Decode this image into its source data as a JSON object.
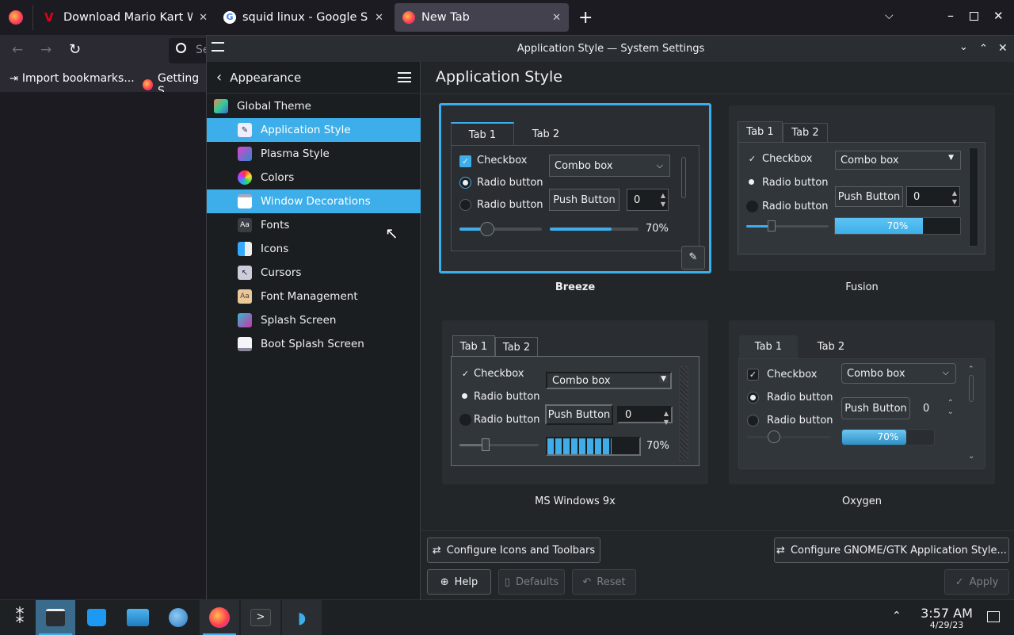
{
  "browser": {
    "tabs": [
      {
        "title": "Download Mario Kart Wii",
        "favicon": "mariokart-icon"
      },
      {
        "title": "squid linux - Google Search",
        "favicon": "google-icon"
      },
      {
        "title": "New Tab",
        "favicon": "firefox-icon"
      }
    ],
    "search_placeholder": "Se",
    "bookmarks": [
      "Import bookmarks...",
      "Getting S"
    ],
    "colors": {
      "bg": "#1c1b22",
      "toolbar": "#2b2a33"
    }
  },
  "window": {
    "title": "Application Style — System Settings"
  },
  "sidebar": {
    "header": "Appearance",
    "items": [
      {
        "label": "Global Theme",
        "icon": "global-theme-icon",
        "indent": false
      },
      {
        "label": "Application Style",
        "icon": "application-style-icon",
        "selected": true
      },
      {
        "label": "Plasma Style",
        "icon": "plasma-style-icon"
      },
      {
        "label": "Colors",
        "icon": "colors-icon"
      },
      {
        "label": "Window Decorations",
        "icon": "window-decorations-icon",
        "hovered": true
      },
      {
        "label": "Fonts",
        "icon": "fonts-icon"
      },
      {
        "label": "Icons",
        "icon": "icons-icon"
      },
      {
        "label": "Cursors",
        "icon": "cursors-icon"
      },
      {
        "label": "Font Management",
        "icon": "font-management-icon"
      },
      {
        "label": "Splash Screen",
        "icon": "splash-screen-icon"
      },
      {
        "label": "Boot Splash Screen",
        "icon": "boot-splash-icon"
      }
    ]
  },
  "main": {
    "title": "Application Style",
    "styles": [
      {
        "name": "Breeze",
        "selected": true
      },
      {
        "name": "Fusion"
      },
      {
        "name": "MS Windows 9x"
      },
      {
        "name": "Oxygen"
      }
    ],
    "preview": {
      "tab1": "Tab 1",
      "tab2": "Tab 2",
      "checkbox": "Checkbox",
      "radio": "Radio button",
      "combo": "Combo box",
      "push": "Push Button",
      "spin": "0",
      "progress_pct": "70%",
      "progress_value": 0.7,
      "slider_value": 0.3
    },
    "buttons": {
      "configure_icons": "Configure Icons and Toolbars",
      "configure_gtk": "Configure GNOME/GTK Application Style...",
      "help": "Help",
      "defaults": "Defaults",
      "reset": "Reset",
      "apply": "Apply"
    },
    "accent": "#3daee9"
  },
  "taskbar": {
    "time": "3:57 AM",
    "date": "4/29/23",
    "apps": [
      "app-launcher-icon",
      "system-settings-icon",
      "discover-icon",
      "file-manager-icon",
      "browser-globe-icon",
      "firefox-icon",
      "terminal-icon",
      "dolphin-icon"
    ]
  }
}
